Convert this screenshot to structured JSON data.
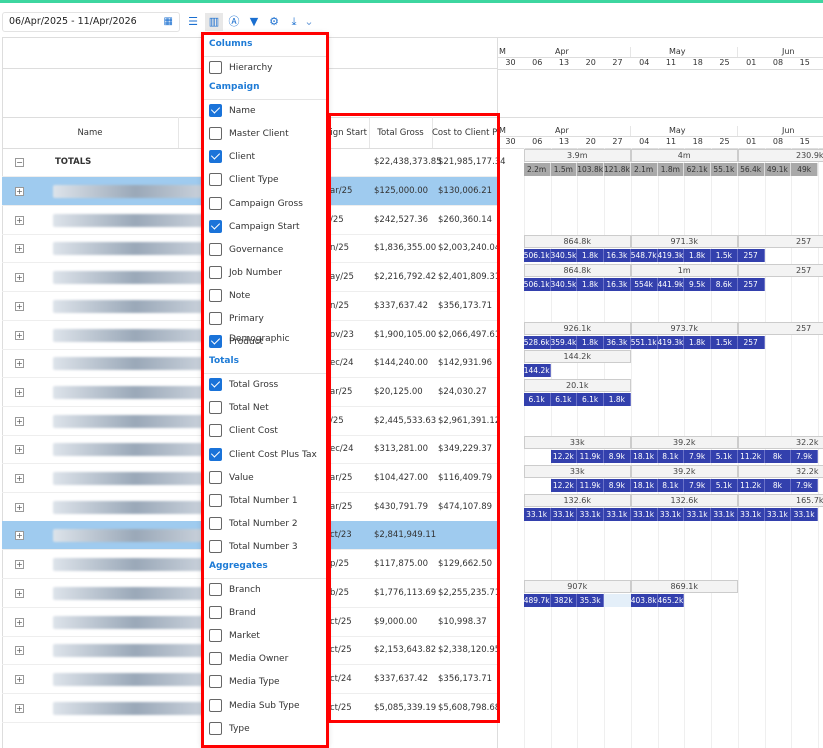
{
  "toolbar": {
    "date_range": "06/Apr/2025 - 11/Apr/2026",
    "icons": [
      "calendar-icon",
      "list-icon",
      "columns-icon",
      "at-icon",
      "filter-icon",
      "gear-icon",
      "download-icon",
      "chevron-down-icon"
    ]
  },
  "grid": {
    "headers": {
      "name": "Name",
      "campaign_start": "aign Start",
      "total_gross": "Total Gross",
      "cost_to_client": "Cost to Client Plus"
    },
    "totals": {
      "label": "TOTALS",
      "total_gross": "$22,438,373.85",
      "cost_to_client": "$21,985,177.34"
    },
    "rows": [
      {
        "start": "ar/25",
        "gross": "$125,000.00",
        "cost": "$130,006.21",
        "selected": true
      },
      {
        "start": "/25",
        "gross": "$242,527.36",
        "cost": "$260,360.14"
      },
      {
        "start": "n/25",
        "gross": "$1,836,355.00",
        "cost": "$2,003,240.04"
      },
      {
        "start": "ay/25",
        "gross": "$2,216,792.42",
        "cost": "$2,401,809.31"
      },
      {
        "start": "n/25",
        "gross": "$337,637.42",
        "cost": "$356,173.71"
      },
      {
        "start": "ov/23",
        "gross": "$1,900,105.00",
        "cost": "$2,066,497.61"
      },
      {
        "start": "ec/24",
        "gross": "$144,240.00",
        "cost": "$142,931.96"
      },
      {
        "start": "ar/25",
        "gross": "$20,125.00",
        "cost": "$24,030.27"
      },
      {
        "start": "/25",
        "gross": "$2,445,533.63",
        "cost": "$2,961,391.12"
      },
      {
        "start": "ec/24",
        "gross": "$313,281.00",
        "cost": "$349,229.37"
      },
      {
        "start": "ar/25",
        "gross": "$104,427.00",
        "cost": "$116,409.79"
      },
      {
        "start": "ar/25",
        "gross": "$430,791.79",
        "cost": "$474,107.89"
      },
      {
        "start": "ct/23",
        "gross": "$2,841,949.11",
        "cost": "",
        "selected": true
      },
      {
        "start": "p/25",
        "gross": "$117,875.00",
        "cost": "$129,662.50"
      },
      {
        "start": "b/25",
        "gross": "$1,776,113.69",
        "cost": "$2,255,235.71"
      },
      {
        "start": "ct/25",
        "gross": "$9,000.00",
        "cost": "$10,998.37"
      },
      {
        "start": "ct/25",
        "gross": "$2,153,643.82",
        "cost": "$2,338,120.95"
      },
      {
        "start": "ct/24",
        "gross": "$337,637.42",
        "cost": "$356,173.71"
      },
      {
        "start": "ct/25",
        "gross": "$5,085,339.19",
        "cost": "$5,608,798.68"
      }
    ]
  },
  "timeline": {
    "months": [
      "M",
      "Apr",
      "May",
      "Jun"
    ],
    "weeks": [
      "30",
      "06",
      "13",
      "20",
      "27",
      "04",
      "11",
      "18",
      "25",
      "01",
      "08",
      "15"
    ],
    "totals": {
      "months": [
        "3.9m",
        "4m",
        "230.9k"
      ],
      "week_start": 1,
      "weeks": [
        "2.2m",
        "1.5m",
        "103.8k",
        "121.8k",
        "2.1m",
        "1.8m",
        "62.1k",
        "55.1k",
        "56.4k",
        "49.1k",
        "49k"
      ]
    },
    "rows": [
      null,
      null,
      {
        "months": [
          "864.8k",
          "971.3k",
          "257"
        ],
        "week_start": 1,
        "weeks": [
          "506.1k",
          "340.5k",
          "1.8k",
          "16.3k",
          "548.7k",
          "419.3k",
          "1.8k",
          "1.5k",
          "257"
        ]
      },
      {
        "months": [
          "864.8k",
          "1m",
          "257"
        ],
        "week_start": 1,
        "weeks": [
          "506.1k",
          "340.5k",
          "1.8k",
          "16.3k",
          "554k",
          "441.9k",
          "9.5k",
          "8.6k",
          "257"
        ]
      },
      null,
      {
        "months": [
          "926.1k",
          "973.7k",
          "257"
        ],
        "week_start": 1,
        "weeks": [
          "528.6k",
          "359.4k",
          "1.8k",
          "36.3k",
          "551.1k",
          "419.3k",
          "1.8k",
          "1.5k",
          "257"
        ]
      },
      {
        "months": [
          "144.2k"
        ],
        "week_start": 1,
        "weeks": [
          "144.2k"
        ]
      },
      {
        "months": [
          "20.1k"
        ],
        "week_start": 1,
        "weeks": [
          "6.1k",
          "6.1k",
          "6.1k",
          "1.8k"
        ]
      },
      null,
      {
        "months": [
          "33k",
          "39.2k",
          "32.2k"
        ],
        "week_start": 2,
        "weeks": [
          "12.2k",
          "11.9k",
          "8.9k",
          "18.1k",
          "8.1k",
          "7.9k",
          "5.1k",
          "11.2k",
          "8k",
          "7.9k"
        ]
      },
      {
        "months": [
          "33k",
          "39.2k",
          "32.2k"
        ],
        "week_start": 2,
        "weeks": [
          "12.2k",
          "11.9k",
          "8.9k",
          "18.1k",
          "8.1k",
          "7.9k",
          "5.1k",
          "11.2k",
          "8k",
          "7.9k"
        ]
      },
      {
        "months": [
          "132.6k",
          "132.6k",
          "165.7k"
        ],
        "week_start": 1,
        "weeks": [
          "33.1k",
          "33.1k",
          "33.1k",
          "33.1k",
          "33.1k",
          "33.1k",
          "33.1k",
          "33.1k",
          "33.1k",
          "33.1k",
          "33.1k"
        ]
      },
      null,
      null,
      {
        "months": [
          "907k",
          "869.1k"
        ],
        "week_start": 1,
        "weeks": [
          "489.7k",
          "382k",
          "35.3k",
          null,
          "403.8k",
          "465.2k"
        ]
      },
      null,
      null,
      null,
      null
    ]
  },
  "menu": {
    "sections": [
      {
        "title": "Columns",
        "items": [
          {
            "label": "Hierarchy",
            "checked": false
          }
        ]
      },
      {
        "title": "Campaign",
        "items": [
          {
            "label": "Name",
            "checked": true
          },
          {
            "label": "Master Client",
            "checked": false
          },
          {
            "label": "Client",
            "checked": true
          },
          {
            "label": "Client Type",
            "checked": false
          },
          {
            "label": "Campaign Gross",
            "checked": false
          },
          {
            "label": "Campaign Start",
            "checked": true
          },
          {
            "label": "Governance",
            "checked": false
          },
          {
            "label": "Job Number",
            "checked": false
          },
          {
            "label": "Note",
            "checked": false
          },
          {
            "label": "Primary Demographic",
            "checked": false
          },
          {
            "label": "Product",
            "checked": true
          }
        ]
      },
      {
        "title": "Totals",
        "items": [
          {
            "label": "Total Gross",
            "checked": true
          },
          {
            "label": "Total Net",
            "checked": false
          },
          {
            "label": "Client Cost",
            "checked": false
          },
          {
            "label": "Client Cost Plus Tax",
            "checked": true
          },
          {
            "label": "Value",
            "checked": false
          },
          {
            "label": "Total Number 1",
            "checked": false
          },
          {
            "label": "Total Number 2",
            "checked": false
          },
          {
            "label": "Total Number 3",
            "checked": false
          }
        ]
      },
      {
        "title": "Aggregates",
        "items": [
          {
            "label": "Branch",
            "checked": false
          },
          {
            "label": "Brand",
            "checked": false
          },
          {
            "label": "Market",
            "checked": false
          },
          {
            "label": "Media Owner",
            "checked": false
          },
          {
            "label": "Media Type",
            "checked": false
          },
          {
            "label": "Media Sub Type",
            "checked": false
          },
          {
            "label": "Type",
            "checked": false
          }
        ]
      }
    ]
  },
  "colors": {
    "accent": "#1a73d9",
    "week_bar": "#3340ad",
    "selected_row": "#9fcbef",
    "highlight": "#ff0000",
    "top_bar": "#3dd6a0"
  }
}
